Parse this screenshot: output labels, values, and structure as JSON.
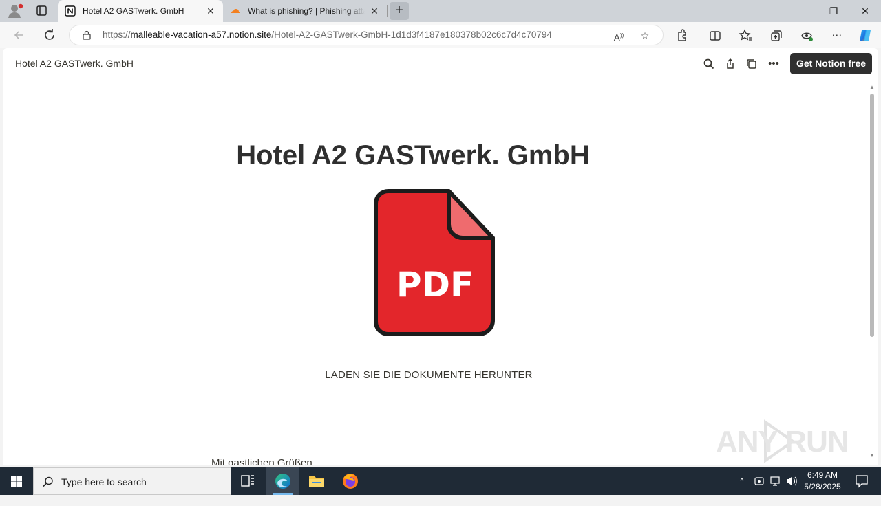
{
  "browser": {
    "tabs": [
      {
        "title": "Hotel A2 GASTwerk. GmbH",
        "close": "✕"
      },
      {
        "title": "What is phishing? | Phishing attack",
        "close": "✕"
      }
    ],
    "new_tab": "+",
    "window_controls": {
      "minimize": "—",
      "maximize": "❐",
      "close": "✕"
    },
    "url_prefix": "https://",
    "url_host": "malleable-vacation-a57.notion.site",
    "url_path": "/Hotel-A2-GASTwerk-GmbH-1d1d3f4187e180378b02c6c7d4c70794"
  },
  "page": {
    "breadcrumb": "Hotel A2 GASTwerk. GmbH",
    "get_notion_label": "Get Notion free",
    "title": "Hotel A2 GASTwerk. GmbH",
    "pdf_label": "PDF",
    "download_link": "LADEN SIE DIE DOKUMENTE HERUNTER",
    "greeting": "Mit gastlichen Grüßen"
  },
  "watermark": "ANY RUN",
  "taskbar": {
    "search_placeholder": "Type here to search",
    "time": "6:49 AM",
    "date": "5/28/2025"
  },
  "colors": {
    "pdf_red": "#e3262b",
    "pdf_fold": "#ef6b6e",
    "notion_dark": "#2f2f2f",
    "taskbar_bg": "#1f2a36"
  }
}
